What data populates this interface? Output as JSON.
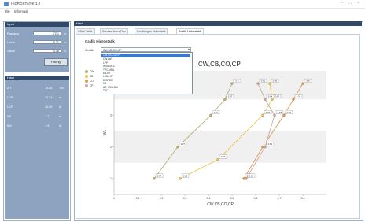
{
  "window": {
    "title": "HIDROSTATIK 1.0",
    "controls": "– □ ×"
  },
  "menu": [
    "File",
    "Informasi"
  ],
  "input_panel": {
    "title": "Input",
    "fields": [
      {
        "label": "Panjang",
        "value": "72.1",
        "unit": "m"
      },
      {
        "label": "Lebar",
        "value": "8.71",
        "unit": "m"
      },
      {
        "label": "Sarat",
        "value": "3.36",
        "unit": "m"
      }
    ],
    "button": "Hitung"
  },
  "result_panel": {
    "title": "Hasil",
    "rows": [
      {
        "label": "Δ T",
        "value": "75.86",
        "unit": "Ton"
      },
      {
        "label": "LCB",
        "value": "36.21",
        "unit": "m"
      },
      {
        "label": "LCF",
        "value": "36.09",
        "unit": "m"
      },
      {
        "label": "KB",
        "value": "1.77",
        "unit": "m"
      },
      {
        "label": "BM",
        "value": "1.97",
        "unit": "m"
      }
    ]
  },
  "main": {
    "title": "Hasil",
    "tabs": [
      "Offset Table",
      "Gambar Lines Plan",
      "Perhitungan Hidrostatik",
      "Grafik Hidrostatik"
    ],
    "active_tab": 3,
    "heading": "Grafik Hidrostatik",
    "combo_label": "Grafik",
    "combo_value": "CW,CB,CO,CP",
    "dropdown": [
      "CW,CB,CO,CP",
      "CW,LWL",
      "LPP",
      "WSA-MTC",
      "TPC,MSA",
      "KB-KT",
      "LCB-LCF",
      "DISP,BM",
      "KB",
      "Δ T, MSA,BM",
      "TPC"
    ]
  },
  "chart_data": {
    "type": "line",
    "title": "CW,CB,CO,CP",
    "xlabel": "CW,CB,CO,CP",
    "ylabel": "WL",
    "xlim": [
      0,
      0.9
    ],
    "ylim": [
      0.5,
      4.4
    ],
    "xticks": [
      "0",
      "0.1",
      "0.2",
      "0.3",
      "0.4",
      "0.5",
      "0.6",
      "0.7",
      "0.8"
    ],
    "yticks": [
      "1",
      "2",
      "3",
      "4"
    ],
    "grid": true,
    "legend_placement": "left",
    "series": [
      {
        "name": "CW",
        "color": "#b5b072",
        "x": [
          0.17,
          0.27,
          0.41,
          0.47,
          0.5
        ],
        "y": [
          1,
          2,
          3,
          3.5,
          4
        ],
        "labels": [
          "0.17",
          "0.27",
          "0.41",
          "0.47",
          "0.5"
        ]
      },
      {
        "name": "CB",
        "color": "#e8c64a",
        "x": [
          0.28,
          0.44,
          0.63,
          0.67,
          0.66
        ],
        "y": [
          1,
          1.6,
          3,
          3.5,
          4
        ],
        "labels": [
          "0.28",
          "0.44",
          "0.63",
          "0.67",
          "0.66"
        ]
      },
      {
        "name": "CO",
        "color": "#d89a55",
        "x": [
          0.55,
          0.63,
          0.72,
          0.76,
          0.8
        ],
        "y": [
          1,
          2,
          3,
          3.5,
          4
        ],
        "labels": [
          "0.55",
          "0.63",
          "0.72",
          "0.76",
          "0.8"
        ]
      },
      {
        "name": "CP",
        "color": "#c9a8a2",
        "x": [
          0.56,
          0.64,
          0.68,
          0.64,
          0.61
        ],
        "y": [
          1,
          2,
          3,
          3.5,
          4
        ],
        "labels": [
          "0.56",
          "0.64",
          "0.68",
          "0.64",
          "0.61"
        ]
      }
    ]
  }
}
